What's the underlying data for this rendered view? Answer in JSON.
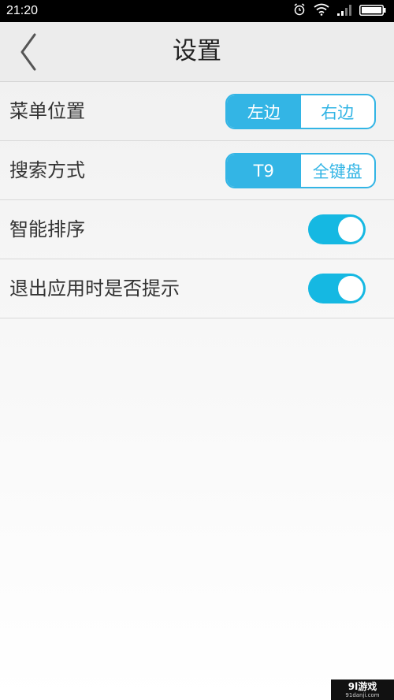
{
  "status_bar": {
    "time": "21:20",
    "icons": [
      "alarm-icon",
      "wifi-icon",
      "signal-icon",
      "battery-icon"
    ]
  },
  "header": {
    "title": "设置",
    "back_icon": "chevron-left-icon"
  },
  "settings": {
    "menu_position": {
      "label": "菜单位置",
      "options": [
        "左边",
        "右边"
      ],
      "selected": "左边"
    },
    "search_mode": {
      "label": "搜索方式",
      "options": [
        "T9",
        "全键盘"
      ],
      "selected": "T9"
    },
    "smart_sort": {
      "label": "智能排序",
      "enabled": true
    },
    "exit_prompt": {
      "label": "退出应用时是否提示",
      "enabled": true
    }
  },
  "watermark": {
    "logo": "9l游戏",
    "site": "91danji.com"
  },
  "colors": {
    "accent": "#33b5e5",
    "toggle_on": "#15b8e2",
    "status_bar": "#000000",
    "title_bar": "#ececec"
  }
}
